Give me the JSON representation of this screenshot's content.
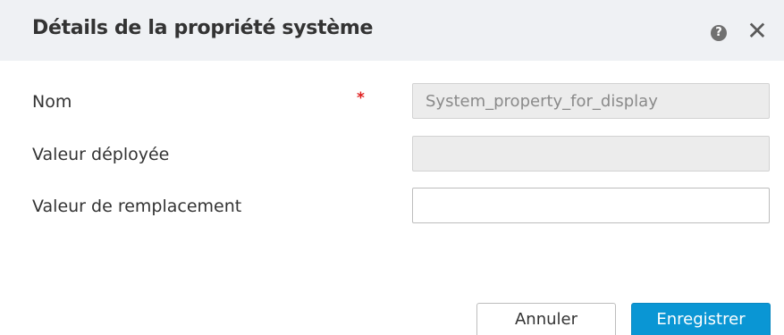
{
  "dialog": {
    "title": "Détails de la propriété système",
    "help_icon": "help-icon",
    "help_glyph": "?",
    "close_icon": "close-icon",
    "close_glyph": "✕"
  },
  "form": {
    "name": {
      "label": "Nom",
      "required_marker": "*",
      "value": "System_property_for_display"
    },
    "deployed_value": {
      "label": "Valeur déployée",
      "value": ""
    },
    "override_value": {
      "label": "Valeur de remplacement",
      "value": ""
    }
  },
  "buttons": {
    "cancel_label": "Annuler",
    "save_label": "Enregistrer"
  },
  "colors": {
    "header_bg": "#eff1f4",
    "primary_button": "#0a96d4",
    "required": "#e02020"
  }
}
